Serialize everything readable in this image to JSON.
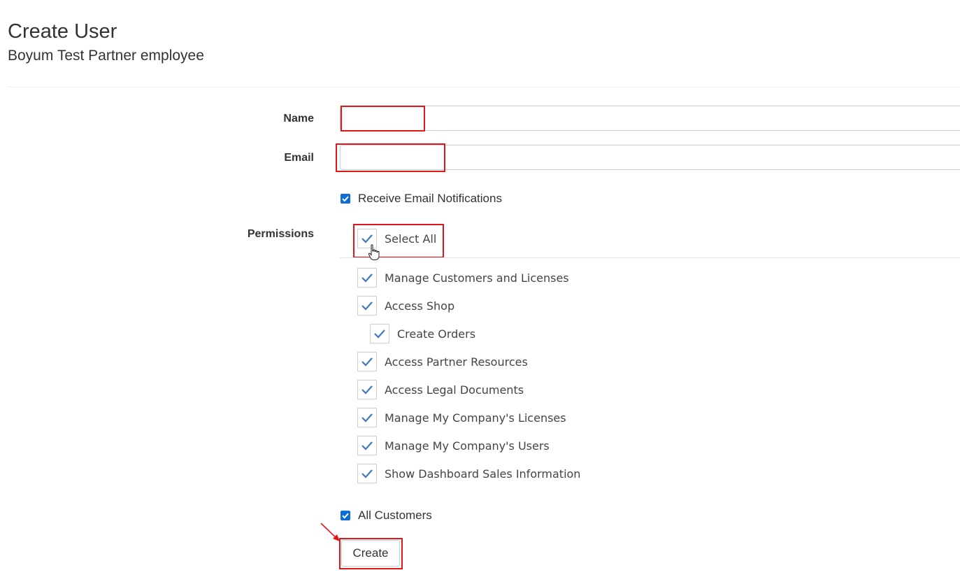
{
  "page": {
    "title": "Create User",
    "subtitle": "Boyum Test Partner employee"
  },
  "form": {
    "name_label": "Name",
    "name_value": "",
    "email_label": "Email",
    "email_value": "",
    "receive_notifications_label": "Receive Email Notifications",
    "receive_notifications_checked": true,
    "permissions_label": "Permissions",
    "select_all_label": "Select All",
    "permissions": [
      {
        "label": "Manage Customers and Licenses",
        "checked": true,
        "indent": 0
      },
      {
        "label": "Access Shop",
        "checked": true,
        "indent": 0
      },
      {
        "label": "Create Orders",
        "checked": true,
        "indent": 1
      },
      {
        "label": "Access Partner Resources",
        "checked": true,
        "indent": 0
      },
      {
        "label": "Access Legal Documents",
        "checked": true,
        "indent": 0
      },
      {
        "label": "Manage My Company's Licenses",
        "checked": true,
        "indent": 0
      },
      {
        "label": "Manage My Company's Users",
        "checked": true,
        "indent": 0
      },
      {
        "label": "Show Dashboard Sales Information",
        "checked": true,
        "indent": 0
      }
    ],
    "all_customers_label": "All Customers",
    "all_customers_checked": true,
    "create_label": "Create"
  },
  "colors": {
    "highlight": "#e0161a",
    "check_blue": "#3a7ac0",
    "native_check": "#0b6dd8"
  },
  "icons": {
    "check": "checkmark-icon",
    "cursor": "hand-pointer-icon",
    "annotation": "red-arrow-icon"
  }
}
